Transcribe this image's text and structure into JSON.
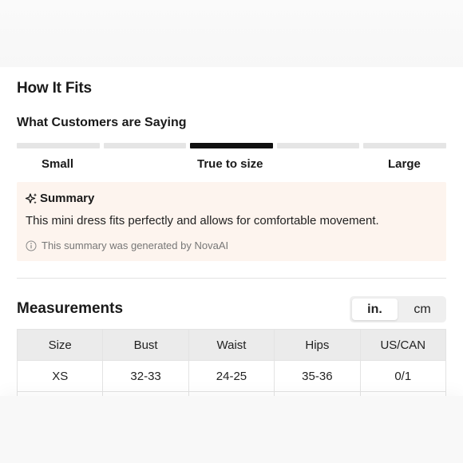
{
  "fit": {
    "section_title": "How It Fits",
    "subhead": "What Customers are Saying",
    "segments": 5,
    "active_segment": 3,
    "labels": {
      "small": "Small",
      "middle": "True to size",
      "large": "Large"
    }
  },
  "summary": {
    "heading": "Summary",
    "text": "This mini dress fits perfectly and allows for comfortable movement.",
    "note": "This summary was generated by NovaAI",
    "background_color": "#fdf4ee"
  },
  "measurements": {
    "title": "Measurements",
    "units": {
      "active": "in.",
      "alternate": "cm"
    },
    "columns": [
      "Size",
      "Bust",
      "Waist",
      "Hips",
      "US/CAN"
    ],
    "rows": [
      [
        "XS",
        "32-33",
        "24-25",
        "35-36",
        "0/1"
      ]
    ]
  },
  "icons": {
    "summary": "sparkle-icon",
    "note": "info-icon"
  }
}
